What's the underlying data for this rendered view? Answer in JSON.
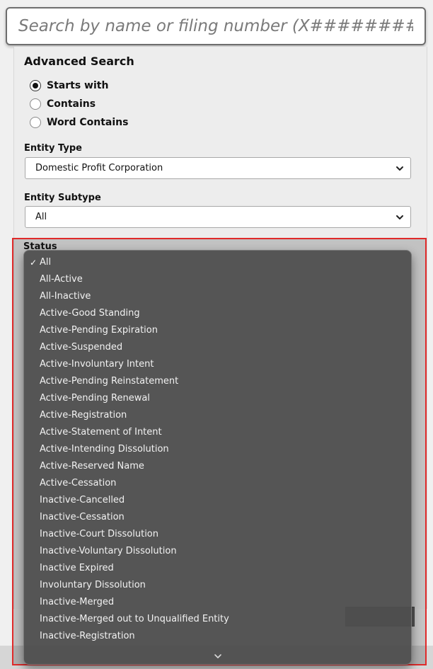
{
  "search": {
    "placeholder": "Search by name or filing number (X########)"
  },
  "advanced_search": {
    "title": "Advanced Search",
    "match_options": [
      {
        "label": "Starts with",
        "checked": true
      },
      {
        "label": "Contains",
        "checked": false
      },
      {
        "label": "Word Contains",
        "checked": false
      }
    ]
  },
  "entity_type": {
    "label": "Entity Type",
    "selected": "Domestic Profit Corporation"
  },
  "entity_subtype": {
    "label": "Entity Subtype",
    "selected": "All"
  },
  "status": {
    "label": "Status",
    "selected": "All",
    "checkmark": "✓",
    "options": [
      "All",
      "All-Active",
      "All-Inactive",
      "Active-Good Standing",
      "Active-Pending Expiration",
      "Active-Suspended",
      "Active-Involuntary Intent",
      "Active-Pending Reinstatement",
      "Active-Pending Renewal",
      "Active-Registration",
      "Active-Statement of Intent",
      "Active-Intending Dissolution",
      "Active-Reserved Name",
      "Active-Cessation",
      "Inactive-Cancelled",
      "Inactive-Cessation",
      "Inactive-Court Dissolution",
      "Inactive-Voluntary Dissolution",
      "Inactive Expired",
      "Involuntary Dissolution",
      "Inactive-Merged",
      "Inactive-Merged out to Unqualified Entity",
      "Inactive-Registration"
    ]
  },
  "colors": {
    "highlight_border": "#e02a2a",
    "dropdown_bg": "#4e4e4e",
    "panel_bg": "#ededed"
  }
}
